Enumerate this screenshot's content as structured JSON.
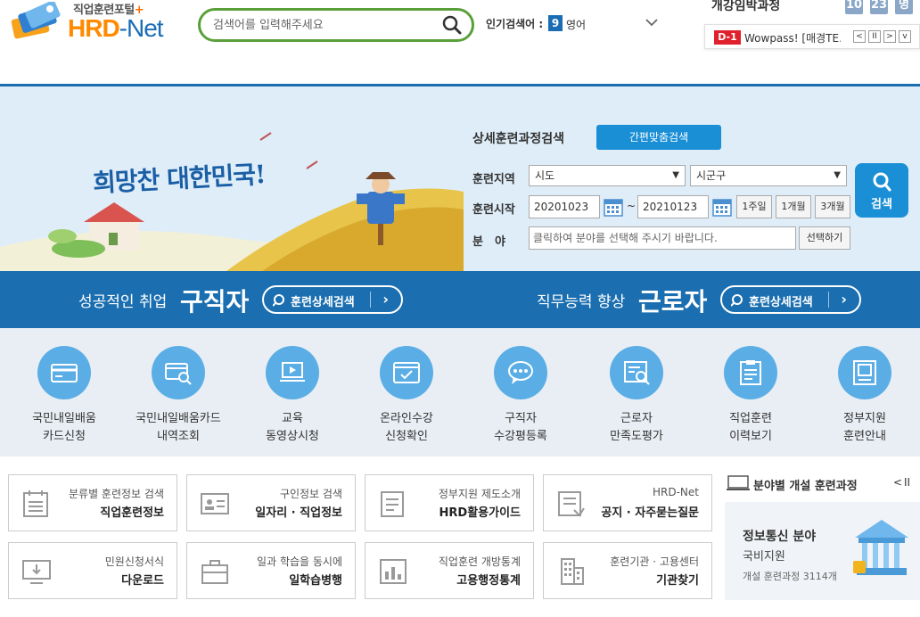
{
  "header": {
    "logo_sub": "직업훈련포털",
    "logo_plus": "+",
    "logo_main_a": "HRD",
    "logo_main_b": "-Net",
    "search_placeholder": "검색어를 입력해주세요",
    "popular_label": "인기검색어 :",
    "popular_rank": "9",
    "popular_word": "영어",
    "open_title": "개강임박과정",
    "counters": [
      "10",
      "23",
      "명"
    ],
    "dday": "D-1",
    "notice": "Wowpass! [매경TE...",
    "nav": [
      "<",
      "II",
      ">",
      "v"
    ]
  },
  "banner": {
    "slogan": "희망찬 대한민국!",
    "form_title": "상세훈련과정검색",
    "quick_search": "간편맞춤검색",
    "region_label": "훈련지역",
    "region_sido": "시도",
    "region_sigungu": "시군구",
    "start_label": "훈련시작",
    "date_from": "20201023",
    "tilde": "~",
    "date_to": "20210123",
    "periods": [
      "1주일",
      "1개월",
      "3개월"
    ],
    "field_label": "분　야",
    "field_placeholder": "클릭하여 분야를 선택해 주시기 바랍니다.",
    "choose": "선택하기",
    "search": "검색"
  },
  "bar": {
    "left_sub": "성공적인 취업",
    "left_main": "구직자",
    "right_sub": "직무능력 향상",
    "right_main": "근로자",
    "btn_label": "훈련상세검색",
    "arrow": "›"
  },
  "icons": [
    {
      "line1": "국민내일배움",
      "line2": "카드신청"
    },
    {
      "line1": "국민내일배움카드",
      "line2": "내역조회"
    },
    {
      "line1": "교육",
      "line2": "동영상시청"
    },
    {
      "line1": "온라인수강",
      "line2": "신청확인"
    },
    {
      "line1": "구직자",
      "line2": "수강평등록"
    },
    {
      "line1": "근로자",
      "line2": "만족도평가"
    },
    {
      "line1": "직업훈련",
      "line2": "이력보기"
    },
    {
      "line1": "정부지원",
      "line2": "훈련안내"
    }
  ],
  "tiles": [
    {
      "sub": "분류별 훈련정보 검색",
      "main": "직업훈련정보"
    },
    {
      "sub": "구인정보 검색",
      "main": "일자리 · 직업정보"
    },
    {
      "sub": "정부지원 제도소개",
      "main": "HRD활용가이드"
    },
    {
      "sub": "HRD-Net",
      "main": "공지 · 자주묻는질문"
    },
    {
      "sub": "민원신청서식",
      "main": "다운로드"
    },
    {
      "sub": "일과 학습을 동시에",
      "main": "일학습병행"
    },
    {
      "sub": "직업훈련 개방통계",
      "main": "고용행정통계"
    },
    {
      "sub": "훈련기관 · 고용센터",
      "main": "기관찾기"
    }
  ],
  "side": {
    "title": "분야별 개설 훈련과정",
    "ctrl_prev": "<",
    "ctrl_pause": "II",
    "card_title": "정보통신 분야",
    "card_sub": "국비지원",
    "card_count": "개설 훈련과정 3114개"
  },
  "colors": {
    "brand_blue": "#1b6fb0",
    "accent_blue": "#1a8fd6",
    "icon_blue": "#5aaee5",
    "search_green": "#5aa03a",
    "logo_orange": "#ff8a00",
    "dday_red": "#e0202c"
  }
}
